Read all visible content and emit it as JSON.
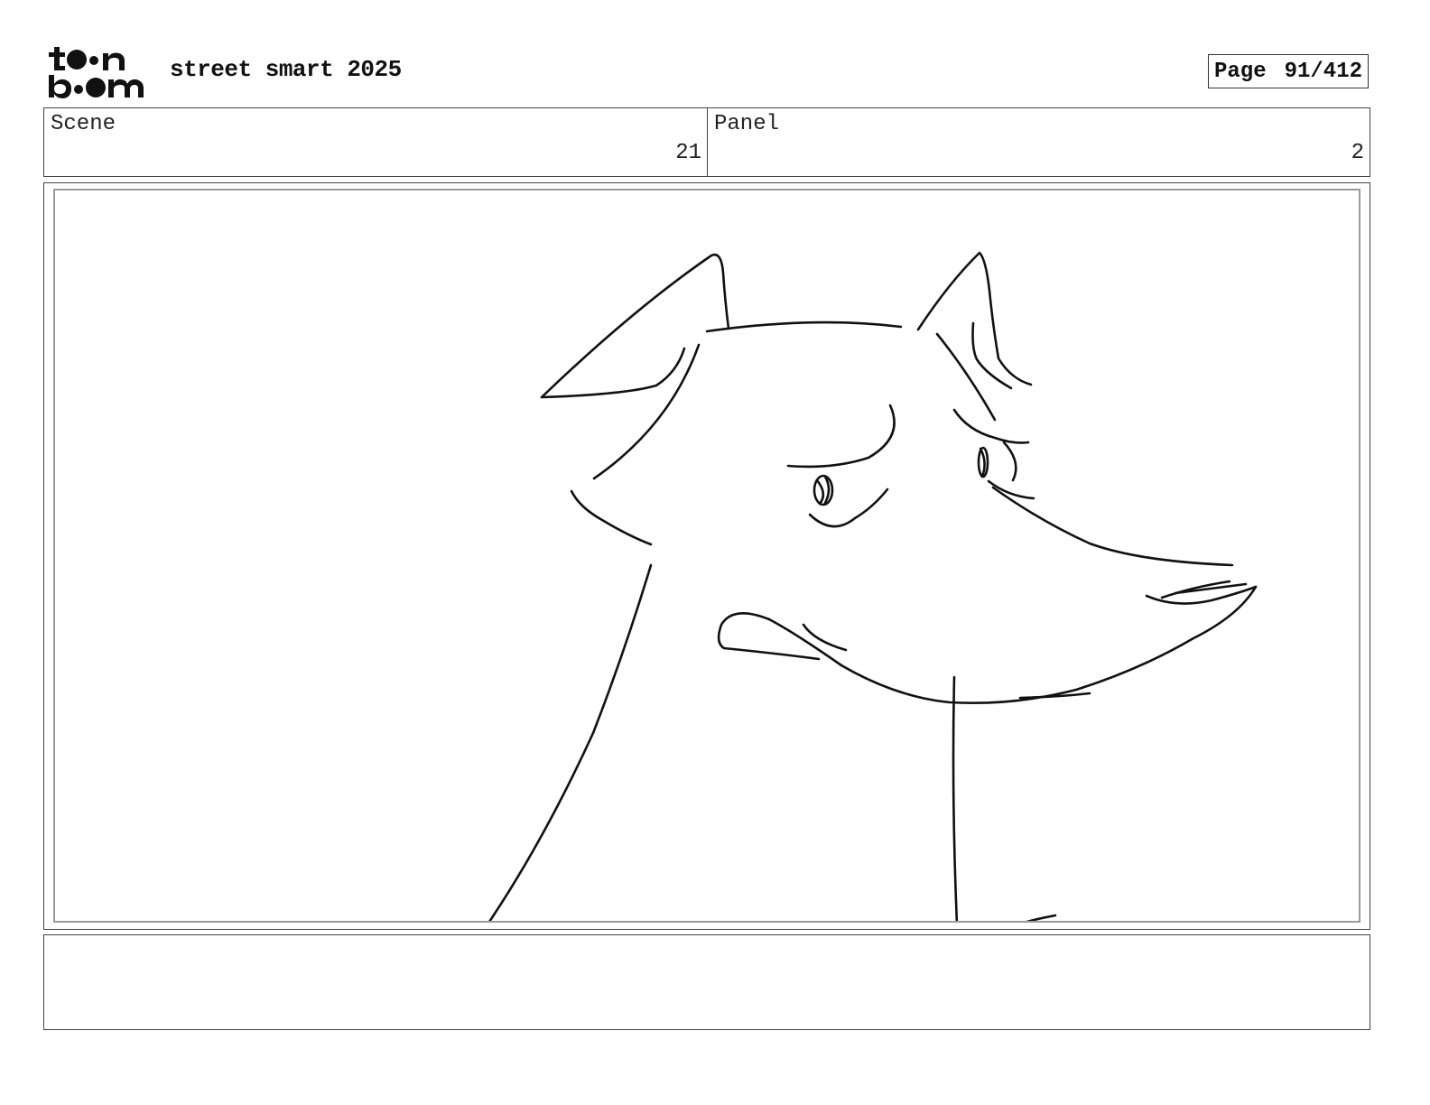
{
  "header": {
    "logo_name": "toon boom",
    "project_title": "street smart 2025",
    "page_label": "Page",
    "page_number": "91/412"
  },
  "info": {
    "scene_label": "Scene",
    "scene_value": "21",
    "panel_label": "Panel",
    "panel_value": "2"
  },
  "notes": {
    "text": ""
  }
}
